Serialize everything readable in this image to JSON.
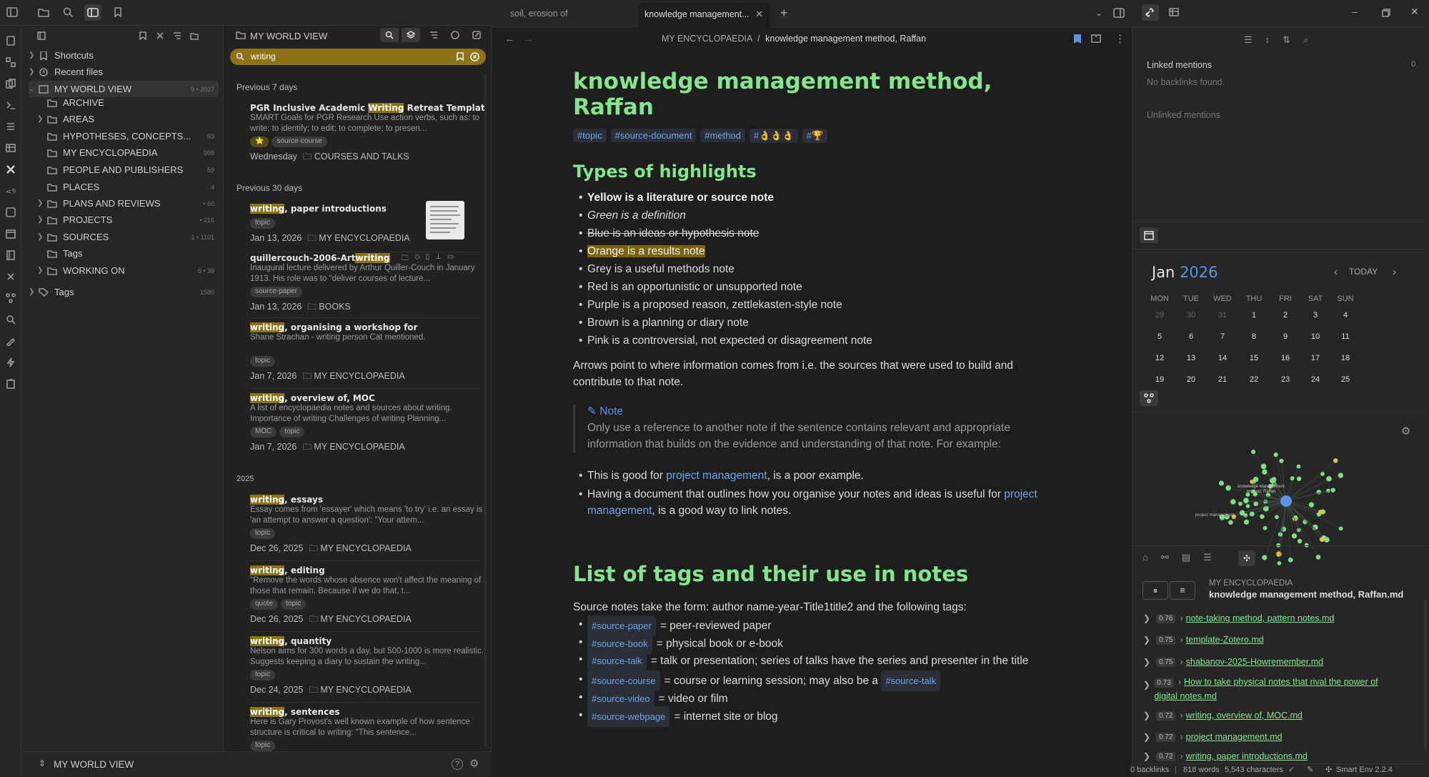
{
  "tabs": {
    "tab1": "soil, erosion of",
    "tab2": "knowledge management..."
  },
  "breadcrumb": {
    "folder": "MY ENCYCLOPAEDIA",
    "sep": "/",
    "note": "knowledge management method, Raffan"
  },
  "tree": {
    "shortcuts": "Shortcuts",
    "recent": "Recent files",
    "root": {
      "label": "MY WORLD VIEW",
      "count": "9 • 2027"
    },
    "items": [
      {
        "label": "ARCHIVE",
        "count": ""
      },
      {
        "label": "AREAS",
        "count": ""
      },
      {
        "label": "HYPOTHESES, CONCEPTS...",
        "count": "93"
      },
      {
        "label": "MY ENCYCLOPAEDIA",
        "count": "998"
      },
      {
        "label": "PEOPLE AND PUBLISHERS",
        "count": "59"
      },
      {
        "label": "PLACES",
        "count": "4"
      },
      {
        "label": "PLANS AND REVIEWS",
        "count": "• 60"
      },
      {
        "label": "PROJECTS",
        "count": "• 216"
      },
      {
        "label": "SOURCES",
        "count": "1 • 1101"
      },
      {
        "label": "Tags",
        "count": ""
      },
      {
        "label": "WORKING ON",
        "count": "6 • 39"
      }
    ],
    "tags": {
      "label": "Tags",
      "count": "1580"
    },
    "vault": "MY WORLD VIEW"
  },
  "search": {
    "header": "MY WORLD VIEW",
    "query": "writing",
    "sec7": "Previous 7 days",
    "sec30": "Previous 30 days",
    "sec2025": "2025",
    "results": [
      {
        "pre": "PGR Inclusive Academic ",
        "hl": "Writing",
        "post": " Retreat Template",
        "desc": "SMART Goals for PGR Research Use action verbs, such as: to write; to identify; to edit; to complete; to presen...",
        "tags": [
          "⭐",
          "source-course"
        ],
        "date": "Wednesday",
        "folder": "COURSES AND TALKS"
      },
      {
        "pre": "",
        "hl": "writing",
        "post": ", paper introductions",
        "desc": "",
        "tags": [
          "topic"
        ],
        "date": "Jan 13, 2026",
        "folder": "MY ENCYCLOPAEDIA"
      },
      {
        "pre": "quillercouch-2006-Art",
        "hl": "writing",
        "post": "",
        "desc": "Inaugural lecture delivered by Arthur Quiller-Couch in January 1913. His role was to \"deliver courses of lecture...",
        "tags": [
          "source-paper"
        ],
        "date": "Jan 13, 2026",
        "folder": "BOOKS"
      },
      {
        "pre": "",
        "hl": "writing",
        "post": ", organising a workshop for",
        "desc": "Shane Strachan - writing person Cat mentioned.",
        "tags": [
          "topic"
        ],
        "date": "Jan 7, 2026",
        "folder": "MY ENCYCLOPAEDIA"
      },
      {
        "pre": "",
        "hl": "writing",
        "post": ", overview of, MOC",
        "desc": "A list of encyclopaedia notes and sources about writing. Importance of writing Challenges of writing Planning...",
        "tags": [
          "MOC",
          "topic"
        ],
        "date": "Jan 7, 2026",
        "folder": "MY ENCYCLOPAEDIA"
      },
      {
        "pre": "",
        "hl": "writing",
        "post": ", essays",
        "desc": "Essay comes from 'essayer' which means 'to try' i.e. an essay is 'an attempt to answer a question': \"Your attem...",
        "tags": [
          "topic"
        ],
        "date": "Dec 26, 2025",
        "folder": "MY ENCYCLOPAEDIA"
      },
      {
        "pre": "",
        "hl": "writing",
        "post": ", editing",
        "desc": "\"Remove the words whose absence won't affect the meaning of those that remain. Because if we do that, t...",
        "tags": [
          "quote",
          "topic"
        ],
        "date": "Dec 26, 2025",
        "folder": "MY ENCYCLOPAEDIA"
      },
      {
        "pre": "",
        "hl": "writing",
        "post": ", quantity",
        "desc": "Nelson aims for 300 words a day, but 500-1000 is more realistic. Suggests keeping a diary to sustain the writing...",
        "tags": [
          "topic"
        ],
        "date": "Dec 24, 2025",
        "folder": "MY ENCYCLOPAEDIA"
      },
      {
        "pre": "",
        "hl": "writing",
        "post": ", sentences",
        "desc": "Here is Gary Provost's well known example of how sentence structure is critical to writing: \"This sentence...",
        "tags": [
          "topic"
        ],
        "date": "",
        "folder": ""
      }
    ]
  },
  "note": {
    "title": "knowledge management method, Raffan",
    "tags": [
      "#topic",
      "#source-document",
      "#method",
      "#👌👌👌",
      "#🏆"
    ],
    "h_highlights": "Types of highlights",
    "highlights": [
      "Yellow is a literature or source note",
      "Green is a definition",
      "Blue is an ideas or hypothesis note",
      "Orange is a results note",
      "Grey is a useful methods note",
      "Red is an opportunistic or unsupported note",
      "Purple is a proposed reason, zettlekasten-style note",
      "Brown is a planning or diary note",
      "Pink is a controversial, not expected or disagreement note"
    ],
    "arrows_para": "Arrows point to where information comes from i.e. the sources that were used to build and contribute to that note.",
    "callout_title": "Note",
    "callout_text": "Only use a reference to another note if the sentence contains relevant and appropriate information that builds on the evidence and understanding of that note. For example:",
    "ex1_pre": "This is good for ",
    "ex1_link": "project management",
    "ex1_post": ", is a poor example.",
    "ex2_pre": "Having a document that outlines how you organise your notes and ideas is useful for ",
    "ex2_link": "project management",
    "ex2_post": ", is a good way to link notes.",
    "h_tags": "List of tags and their use in notes",
    "tags_intro": "Source notes take the form: author name-year-Title1title2 and the following tags:",
    "tag_list": [
      {
        "tag": "#source-paper",
        "desc": "= peer-reviewed paper"
      },
      {
        "tag": "#source-book",
        "desc": "= physical book or e-book"
      },
      {
        "tag": "#source-talk",
        "desc": "= talk or presentation; series of talks have the series and presenter in the title"
      },
      {
        "tag": "#source-course",
        "desc": "= course or learning session; may also be a"
      },
      {
        "tag": "#source-video",
        "desc": "= video or film"
      },
      {
        "tag": "#source-webpage",
        "desc": "= internet site or blog"
      }
    ],
    "course_extra_tag": "#source-talk"
  },
  "backlinks": {
    "linked": "Linked mentions",
    "linked_count": "0",
    "none": "No backlinks found.",
    "unlinked": "Unlinked mentions"
  },
  "calendar": {
    "month": "Jan",
    "year": "2026",
    "today": "TODAY",
    "days": [
      "MON",
      "TUE",
      "WED",
      "THU",
      "FRI",
      "SAT",
      "SUN"
    ],
    "weeks": [
      [
        "29",
        "30",
        "31",
        "1",
        "2",
        "3",
        "4"
      ],
      [
        "5",
        "6",
        "7",
        "8",
        "9",
        "10",
        "11"
      ],
      [
        "12",
        "13",
        "14",
        "15",
        "16",
        "17",
        "18"
      ],
      [
        "19",
        "20",
        "21",
        "22",
        "23",
        "24",
        "25"
      ]
    ]
  },
  "graph": {
    "center_label": "knowledge management method, Raffan",
    "side_label": "project management"
  },
  "smart": {
    "folder": "MY ENCYCLOPAEDIA",
    "file": "knowledge management method, Raffan.md",
    "items": [
      {
        "score": "0.76",
        "name": "note-taking method, pattern notes.md"
      },
      {
        "score": "0.75",
        "name": "template-Zotero.md"
      },
      {
        "score": "0.75",
        "name": "shabanov-2025-Howremember.md"
      },
      {
        "score": "0.73",
        "name": "How to take physical notes that rival the power of digital notes.md"
      },
      {
        "score": "0.72",
        "name": "writing, overview of, MOC.md"
      },
      {
        "score": "0.72",
        "name": "project management.md"
      },
      {
        "score": "0.72",
        "name": "writing, paper introductions.md"
      }
    ]
  },
  "status": {
    "backlinks": "0 backlinks",
    "words": "818 words",
    "chars": "5,543 characters",
    "env": "Smart Env 2.2.4"
  }
}
